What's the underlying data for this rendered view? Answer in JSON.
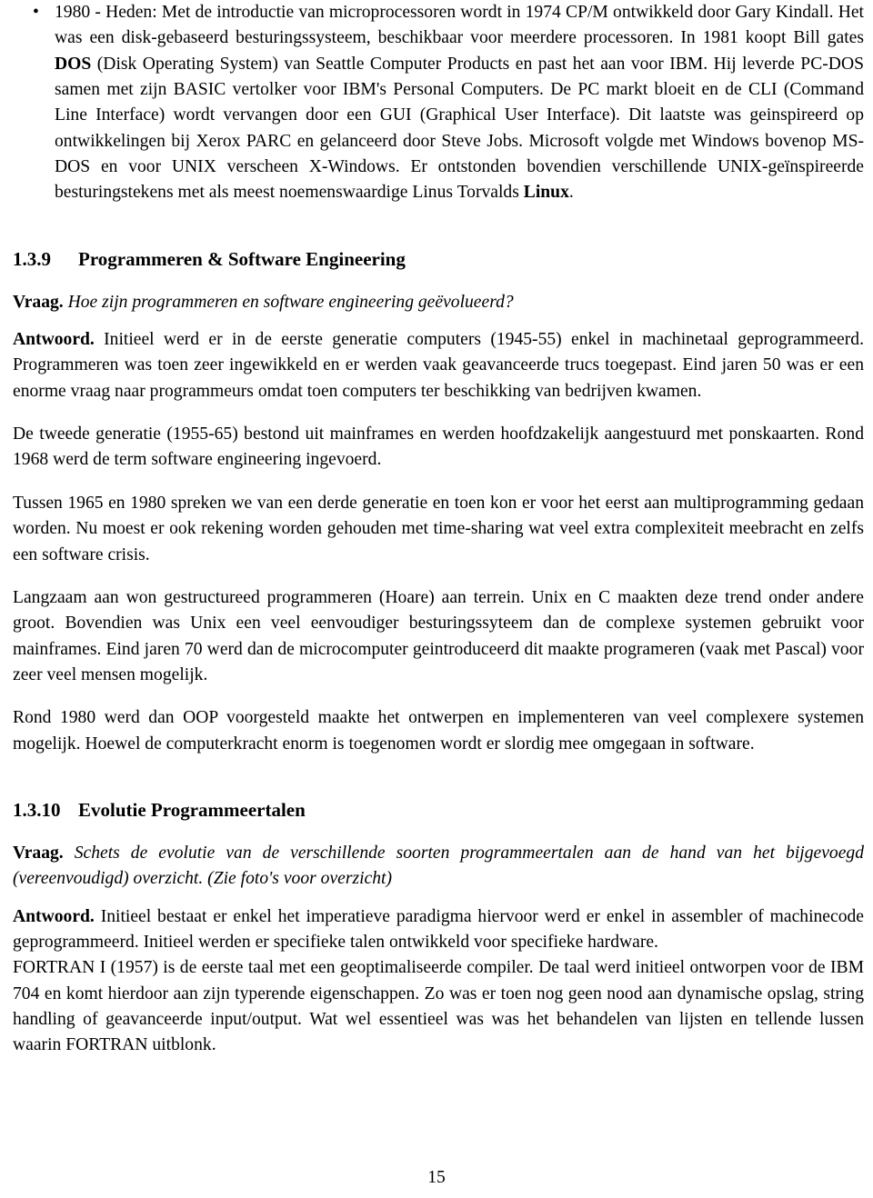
{
  "document": {
    "page_number": "15",
    "language": "nl",
    "bullet_glyph": "•"
  },
  "bullet_item": {
    "text": "1980 - Heden: Met de introductie van microprocessoren wordt in 1974 CP/M ontwikkeld door Gary Kindall. Het was een disk-gebaseerd besturingssysteem, beschikbaar voor meerdere processoren. In 1981 koopt Bill gates ",
    "bold_1": "DOS",
    "text_2": " (Disk Operating System) van Seattle Computer Products en past het aan voor IBM. Hij leverde PC-DOS samen met zijn BASIC vertolker voor IBM's Personal Computers. De PC markt bloeit en de CLI (Command Line Interface) wordt vervangen door een GUI (Graphical User Interface). Dit laatste was geinspireerd op ontwikkelingen bij Xerox PARC en gelanceerd door Steve Jobs. Microsoft volgde met Windows bovenop MS-DOS en voor UNIX verscheen X-Windows. Er ontstonden bovendien verschillende UNIX-geïnspireerde besturingstekens met als meest noemenswaardige Linus Torvalds ",
    "bold_2": "Linux",
    "text_3": "."
  },
  "section_9": {
    "number": "1.3.9",
    "title": "Programmeren & Software Engineering",
    "question_label": "Vraag.",
    "question_text": "Hoe zijn programmeren en software engineering geëvolueerd?",
    "answer_label": "Antwoord.",
    "answer_text": "Initieel werd er in de eerste generatie computers (1945-55) enkel in machinetaal geprogrammeerd. Programmeren was toen zeer ingewikkeld en er werden vaak geavanceerde trucs toegepast. Eind jaren 50 was er een enorme vraag naar programmeurs omdat toen computers ter beschikking van bedrijven kwamen.",
    "paragraph_2": "De tweede generatie (1955-65) bestond uit mainframes en werden hoofdzakelijk aangestuurd met ponskaarten. Rond 1968 werd de term software engineering ingevoerd.",
    "paragraph_3": "Tussen 1965 en 1980 spreken we van een derde generatie en toen kon er voor het eerst aan multiprogramming gedaan worden. Nu moest er ook rekening worden gehouden met time-sharing wat veel extra complexiteit meebracht en zelfs een software crisis.",
    "paragraph_4": "Langzaam aan won gestructureed programmeren (Hoare) aan terrein. Unix en C maakten deze trend onder andere groot. Bovendien was Unix een veel eenvoudiger besturingssyteem dan de complexe systemen gebruikt voor mainframes. Eind jaren 70 werd dan de microcomputer geintroduceerd dit maakte programeren (vaak met Pascal) voor zeer veel mensen mogelijk.",
    "paragraph_5": "Rond 1980 werd dan OOP voorgesteld maakte het ontwerpen en implementeren van veel complexere systemen mogelijk. Hoewel de computerkracht enorm is toegenomen wordt er slordig mee omgegaan in software."
  },
  "section_10": {
    "number": "1.3.10",
    "title": "Evolutie Programmeertalen",
    "question_label": "Vraag.",
    "question_text": "Schets de evolutie van de verschillende soorten programmeertalen aan de hand van het bijgevoegd (vereenvoudigd) overzicht. (Zie foto's voor overzicht)",
    "answer_label": "Antwoord.",
    "answer_text": "Initieel bestaat er enkel het imperatieve paradigma hiervoor werd er enkel in assembler of machinecode geprogrammeerd. Initieel werden er specifieke talen ontwikkeld voor specifieke hardware.",
    "paragraph_2": "FORTRAN I (1957) is de eerste taal met een geoptimaliseerde compiler. De taal werd initieel ontworpen voor de IBM 704 en komt hierdoor aan zijn typerende eigenschappen. Zo was er toen nog geen nood aan dynamische opslag, string handling of geavanceerde input/output. Wat wel essentieel was was het behandelen van lijsten en tellende lussen waarin FORTRAN uitblonk."
  }
}
